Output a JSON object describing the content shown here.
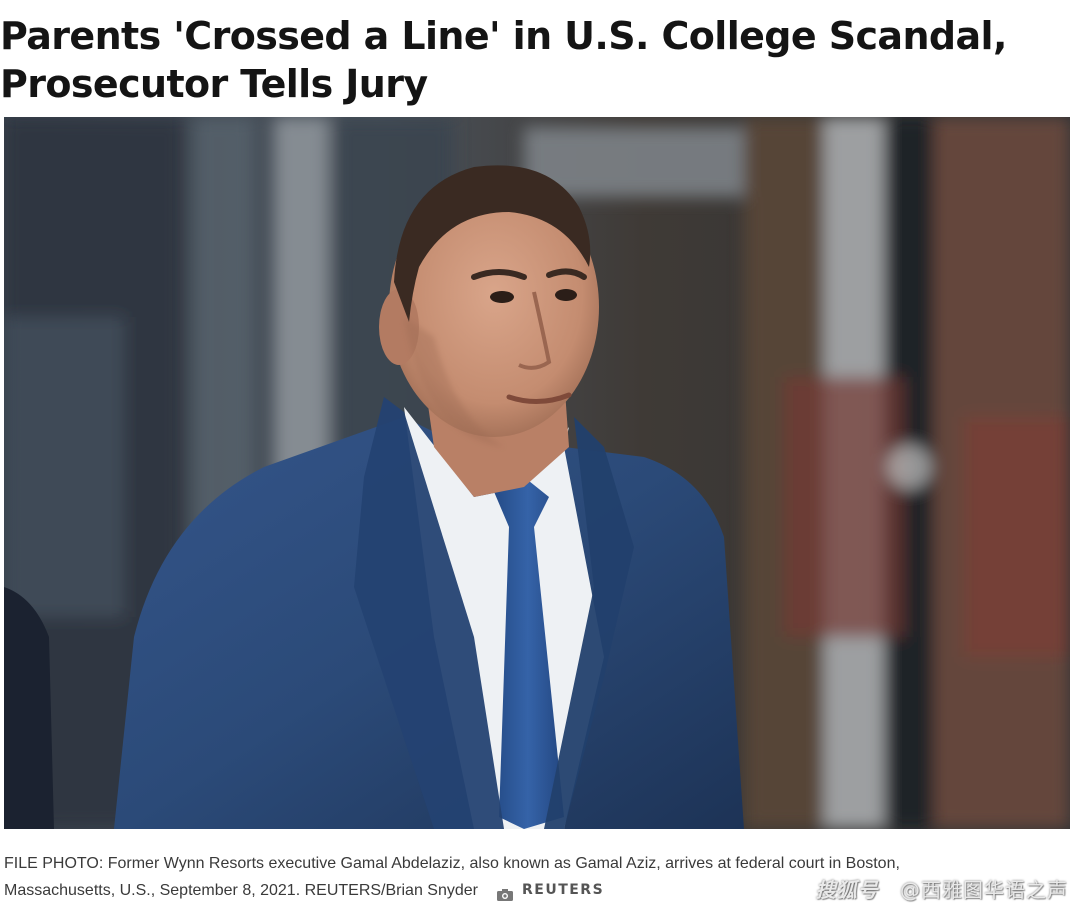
{
  "article": {
    "headline_line1": "Parents 'Crossed a Line' in U.S. College Scandal,",
    "headline_line2": "Prosecutor Tells Jury"
  },
  "photo": {
    "subject": "person-in-suit-photo"
  },
  "caption": {
    "line1": "FILE PHOTO: Former Wynn Resorts executive Gamal Abdelaziz, also known as Gamal Aziz, arrives at federal court in Boston,",
    "line2": "Massachusetts, U.S., September 8, 2021. REUTERS/Brian Snyder",
    "source_logo": "REUTERS",
    "icon": "camera-icon"
  },
  "watermark": {
    "logo": "搜狐号",
    "handle": "@西雅图华语之声"
  },
  "colors": {
    "suit": "#2b4a78",
    "tie": "#2f5a9a",
    "background": "#ffffff"
  }
}
